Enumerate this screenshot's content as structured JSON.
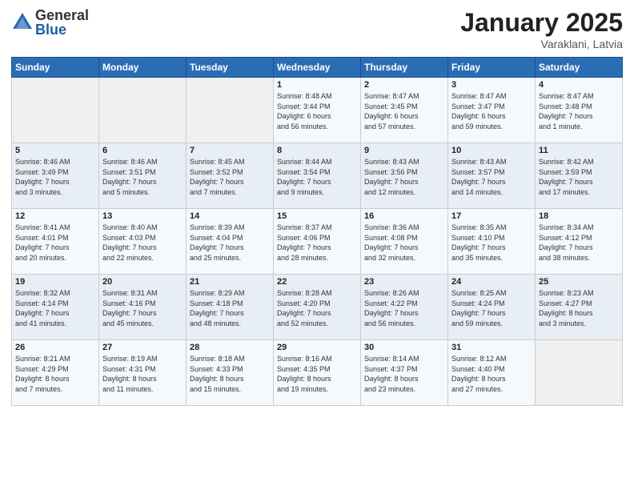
{
  "logo": {
    "general": "General",
    "blue": "Blue"
  },
  "header": {
    "title": "January 2025",
    "subtitle": "Varaklani, Latvia"
  },
  "weekdays": [
    "Sunday",
    "Monday",
    "Tuesday",
    "Wednesday",
    "Thursday",
    "Friday",
    "Saturday"
  ],
  "weeks": [
    [
      {
        "day": "",
        "info": ""
      },
      {
        "day": "",
        "info": ""
      },
      {
        "day": "",
        "info": ""
      },
      {
        "day": "1",
        "info": "Sunrise: 8:48 AM\nSunset: 3:44 PM\nDaylight: 6 hours\nand 56 minutes."
      },
      {
        "day": "2",
        "info": "Sunrise: 8:47 AM\nSunset: 3:45 PM\nDaylight: 6 hours\nand 57 minutes."
      },
      {
        "day": "3",
        "info": "Sunrise: 8:47 AM\nSunset: 3:47 PM\nDaylight: 6 hours\nand 59 minutes."
      },
      {
        "day": "4",
        "info": "Sunrise: 8:47 AM\nSunset: 3:48 PM\nDaylight: 7 hours\nand 1 minute."
      }
    ],
    [
      {
        "day": "5",
        "info": "Sunrise: 8:46 AM\nSunset: 3:49 PM\nDaylight: 7 hours\nand 3 minutes."
      },
      {
        "day": "6",
        "info": "Sunrise: 8:46 AM\nSunset: 3:51 PM\nDaylight: 7 hours\nand 5 minutes."
      },
      {
        "day": "7",
        "info": "Sunrise: 8:45 AM\nSunset: 3:52 PM\nDaylight: 7 hours\nand 7 minutes."
      },
      {
        "day": "8",
        "info": "Sunrise: 8:44 AM\nSunset: 3:54 PM\nDaylight: 7 hours\nand 9 minutes."
      },
      {
        "day": "9",
        "info": "Sunrise: 8:43 AM\nSunset: 3:56 PM\nDaylight: 7 hours\nand 12 minutes."
      },
      {
        "day": "10",
        "info": "Sunrise: 8:43 AM\nSunset: 3:57 PM\nDaylight: 7 hours\nand 14 minutes."
      },
      {
        "day": "11",
        "info": "Sunrise: 8:42 AM\nSunset: 3:59 PM\nDaylight: 7 hours\nand 17 minutes."
      }
    ],
    [
      {
        "day": "12",
        "info": "Sunrise: 8:41 AM\nSunset: 4:01 PM\nDaylight: 7 hours\nand 20 minutes."
      },
      {
        "day": "13",
        "info": "Sunrise: 8:40 AM\nSunset: 4:03 PM\nDaylight: 7 hours\nand 22 minutes."
      },
      {
        "day": "14",
        "info": "Sunrise: 8:39 AM\nSunset: 4:04 PM\nDaylight: 7 hours\nand 25 minutes."
      },
      {
        "day": "15",
        "info": "Sunrise: 8:37 AM\nSunset: 4:06 PM\nDaylight: 7 hours\nand 28 minutes."
      },
      {
        "day": "16",
        "info": "Sunrise: 8:36 AM\nSunset: 4:08 PM\nDaylight: 7 hours\nand 32 minutes."
      },
      {
        "day": "17",
        "info": "Sunrise: 8:35 AM\nSunset: 4:10 PM\nDaylight: 7 hours\nand 35 minutes."
      },
      {
        "day": "18",
        "info": "Sunrise: 8:34 AM\nSunset: 4:12 PM\nDaylight: 7 hours\nand 38 minutes."
      }
    ],
    [
      {
        "day": "19",
        "info": "Sunrise: 8:32 AM\nSunset: 4:14 PM\nDaylight: 7 hours\nand 41 minutes."
      },
      {
        "day": "20",
        "info": "Sunrise: 8:31 AM\nSunset: 4:16 PM\nDaylight: 7 hours\nand 45 minutes."
      },
      {
        "day": "21",
        "info": "Sunrise: 8:29 AM\nSunset: 4:18 PM\nDaylight: 7 hours\nand 48 minutes."
      },
      {
        "day": "22",
        "info": "Sunrise: 8:28 AM\nSunset: 4:20 PM\nDaylight: 7 hours\nand 52 minutes."
      },
      {
        "day": "23",
        "info": "Sunrise: 8:26 AM\nSunset: 4:22 PM\nDaylight: 7 hours\nand 56 minutes."
      },
      {
        "day": "24",
        "info": "Sunrise: 8:25 AM\nSunset: 4:24 PM\nDaylight: 7 hours\nand 59 minutes."
      },
      {
        "day": "25",
        "info": "Sunrise: 8:23 AM\nSunset: 4:27 PM\nDaylight: 8 hours\nand 3 minutes."
      }
    ],
    [
      {
        "day": "26",
        "info": "Sunrise: 8:21 AM\nSunset: 4:29 PM\nDaylight: 8 hours\nand 7 minutes."
      },
      {
        "day": "27",
        "info": "Sunrise: 8:19 AM\nSunset: 4:31 PM\nDaylight: 8 hours\nand 11 minutes."
      },
      {
        "day": "28",
        "info": "Sunrise: 8:18 AM\nSunset: 4:33 PM\nDaylight: 8 hours\nand 15 minutes."
      },
      {
        "day": "29",
        "info": "Sunrise: 8:16 AM\nSunset: 4:35 PM\nDaylight: 8 hours\nand 19 minutes."
      },
      {
        "day": "30",
        "info": "Sunrise: 8:14 AM\nSunset: 4:37 PM\nDaylight: 8 hours\nand 23 minutes."
      },
      {
        "day": "31",
        "info": "Sunrise: 8:12 AM\nSunset: 4:40 PM\nDaylight: 8 hours\nand 27 minutes."
      },
      {
        "day": "",
        "info": ""
      }
    ]
  ]
}
